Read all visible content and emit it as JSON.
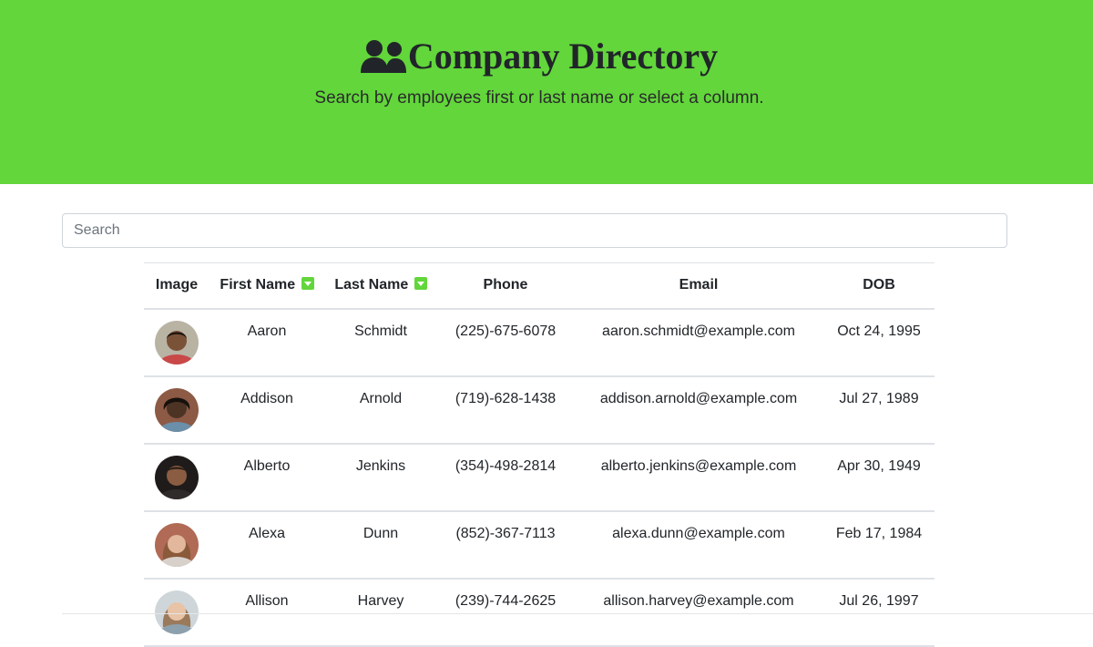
{
  "header": {
    "title": "Company Directory",
    "subtitle": "Search by employees first or last name or select a column.",
    "icon": "users-icon",
    "background_color": "#62d63b"
  },
  "search": {
    "placeholder": "Search",
    "value": ""
  },
  "table": {
    "columns": {
      "image": "Image",
      "first_name": "First Name",
      "last_name": "Last Name",
      "phone": "Phone",
      "email": "Email",
      "dob": "DOB"
    },
    "sort_icon": "caret-down-square-icon",
    "rows": [
      {
        "first": "Aaron",
        "last": "Schmidt",
        "phone": "(225)-675-6078",
        "email": "aaron.schmidt@example.com",
        "dob": "Oct 24, 1995",
        "skin": "#7a5238",
        "hair": "#1d140f",
        "bg": "#b9b3a4",
        "shirt": "#c94848"
      },
      {
        "first": "Addison",
        "last": "Arnold",
        "phone": "(719)-628-1438",
        "email": "addison.arnold@example.com",
        "dob": "Jul 27, 1989",
        "skin": "#4d3324",
        "hair": "#17110d",
        "bg": "#8d5a45",
        "shirt": "#6b8fa8"
      },
      {
        "first": "Alberto",
        "last": "Jenkins",
        "phone": "(354)-498-2814",
        "email": "alberto.jenkins@example.com",
        "dob": "Apr 30, 1949",
        "skin": "#8a5d42",
        "hair": "#2a1d16",
        "bg": "#1f1b1a",
        "shirt": "#2f2b2a"
      },
      {
        "first": "Alexa",
        "last": "Dunn",
        "phone": "(852)-367-7113",
        "email": "alexa.dunn@example.com",
        "dob": "Feb 17, 1984",
        "skin": "#e2b79b",
        "hair": "#8a5a3b",
        "bg": "#b06a55",
        "shirt": "#d8d1cb"
      },
      {
        "first": "Allison",
        "last": "Harvey",
        "phone": "(239)-744-2625",
        "email": "allison.harvey@example.com",
        "dob": "Jul 26, 1997",
        "skin": "#e8c3a6",
        "hair": "#9a7a5a",
        "bg": "#cfd6da",
        "shirt": "#8da0ad"
      }
    ]
  }
}
